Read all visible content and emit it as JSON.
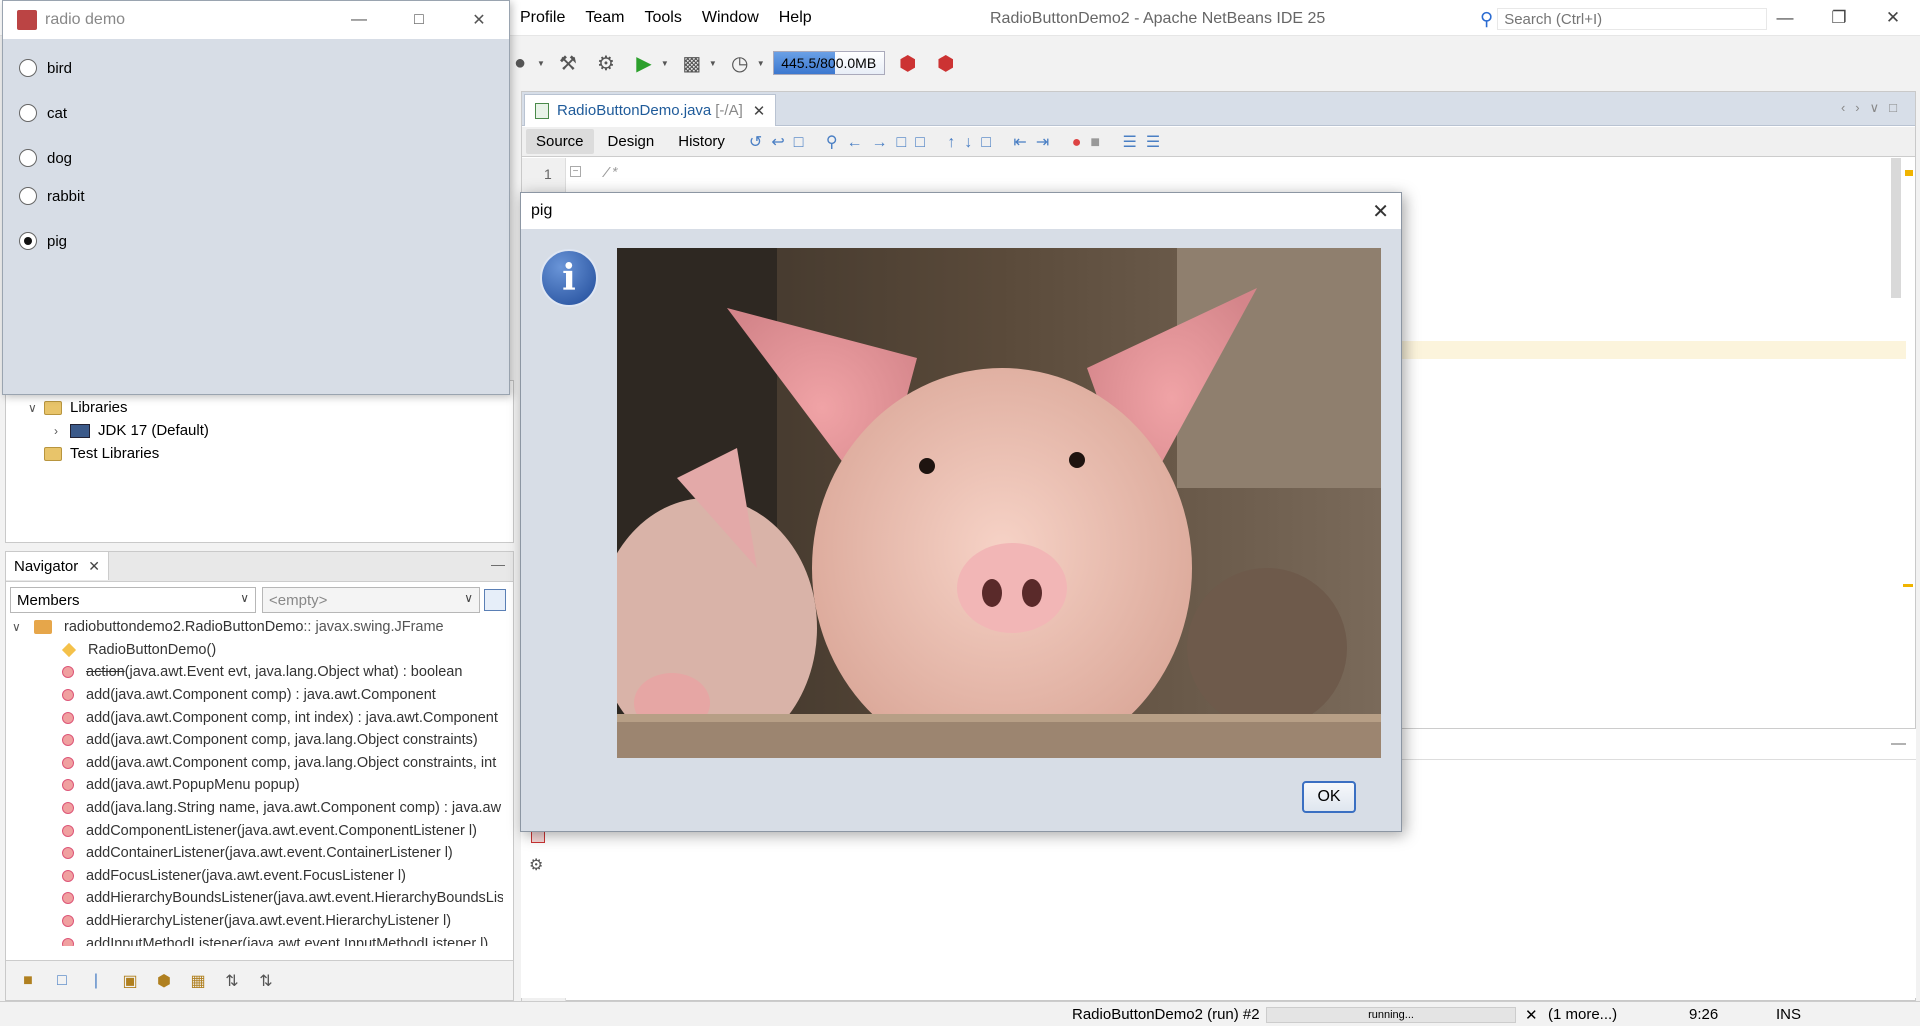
{
  "ide": {
    "title": "RadioButtonDemo2 - Apache NetBeans IDE 25",
    "menu": [
      "Profile",
      "Team",
      "Tools",
      "Window",
      "Help"
    ],
    "search_placeholder": "Search (Ctrl+I)",
    "memory": "445.5/800.0MB",
    "memory_used_fraction": 0.557
  },
  "projects": {
    "libraries": "Libraries",
    "jdk": "JDK 17 (Default)",
    "test_libraries": "Test Libraries"
  },
  "navigator": {
    "tab": "Navigator",
    "filter": "Members",
    "second_combo": "<empty>",
    "root": "radiobuttondemo2.RadioButtonDemo",
    "root_suffix": " :: javax.swing.JFrame",
    "members": [
      {
        "name": "RadioButtonDemo()",
        "kind": "constructor"
      },
      {
        "name": "action",
        "rest": "(java.awt.Event evt, java.lang.Object what) : boolean",
        "kind": "deprecated"
      },
      {
        "name": "add",
        "rest": "(java.awt.Component comp) : java.awt.Component"
      },
      {
        "name": "add",
        "rest": "(java.awt.Component comp, int index) : java.awt.Component"
      },
      {
        "name": "add",
        "rest": "(java.awt.Component comp, java.lang.Object constraints)"
      },
      {
        "name": "add",
        "rest": "(java.awt.Component comp, java.lang.Object constraints, int"
      },
      {
        "name": "add",
        "rest": "(java.awt.PopupMenu popup)"
      },
      {
        "name": "add",
        "rest": "(java.lang.String name, java.awt.Component comp) : java.aw"
      },
      {
        "name": "addComponentListener",
        "rest": "(java.awt.event.ComponentListener l)"
      },
      {
        "name": "addContainerListener",
        "rest": "(java.awt.event.ContainerListener l)"
      },
      {
        "name": "addFocusListener",
        "rest": "(java.awt.event.FocusListener l)"
      },
      {
        "name": "addHierarchyBoundsListener",
        "rest": "(java.awt.event.HierarchyBoundsLis"
      },
      {
        "name": "addHierarchyListener",
        "rest": "(java.awt.event.HierarchyListener l)"
      },
      {
        "name": "addInputMethodListener",
        "rest": "(java.awt.event.InputMethodListener l)"
      }
    ]
  },
  "editor": {
    "tab": "RadioButtonDemo.java",
    "tab_path": "[-/A]",
    "views": [
      "Source",
      "Design",
      "History"
    ],
    "line1": "1",
    "code_line1": "/*"
  },
  "status": {
    "run": "RadioButtonDemo2 (run) #2",
    "progress": "running...",
    "more": "(1 more...)",
    "position": "9:26",
    "mode": "INS"
  },
  "frame": {
    "title": "radio demo",
    "options": [
      "bird",
      "cat",
      "dog",
      "rabbit",
      "pig"
    ],
    "selected": "pig"
  },
  "dialog": {
    "title": "pig",
    "ok": "OK",
    "icon": "information-icon"
  }
}
